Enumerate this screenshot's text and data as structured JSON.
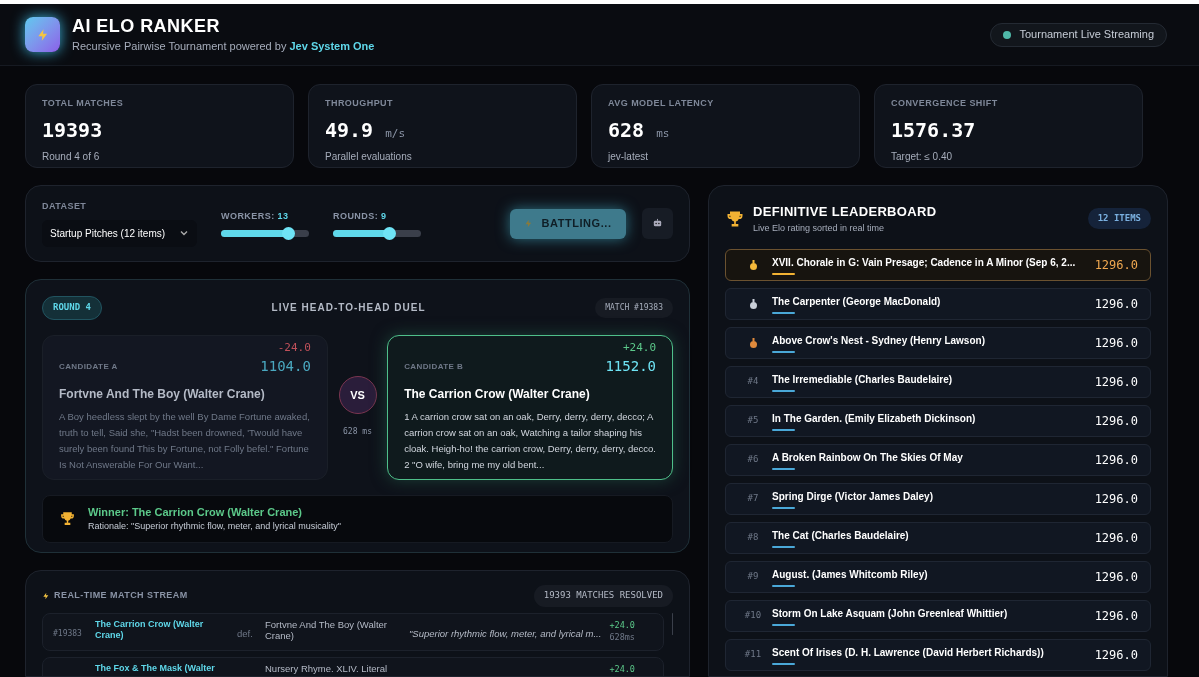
{
  "header": {
    "title": "AI ELO RANKER",
    "subtitle": "Recursive Pairwise Tournament powered by",
    "brand": "Jev System One",
    "status": "Tournament Live Streaming",
    "live": true
  },
  "stats": [
    {
      "label": "TOTAL MATCHES",
      "value": "19393",
      "note": "Round 4 of 6"
    },
    {
      "label": "THROUGHPUT",
      "value": "49.9",
      "unit": "m/s",
      "note": "Parallel evaluations"
    },
    {
      "label": "AVG MODEL LATENCY",
      "value": "628",
      "unit": "ms",
      "note": "jev-latest"
    },
    {
      "label": "CONVERGENCE SHIFT",
      "value": "1576.37",
      "note": "Target: ≤ 0.40"
    }
  ],
  "controls": {
    "dataset_label": "DATASET",
    "dataset": "Startup Pitches (12 items)",
    "sliders": [
      {
        "label": "WORKERS:",
        "value": "13",
        "level": 0.76
      },
      {
        "label": "ROUNDS:",
        "value": "9",
        "level": 0.64
      }
    ],
    "run_button": "BATTLING...",
    "running": true
  },
  "duel": {
    "round": "ROUND 4",
    "title": "LIVE HEAD-TO-HEAD DUEL",
    "match": "MATCH #19383",
    "vs": "VS",
    "latency": "628 ms",
    "candidates": [
      {
        "label": "CANDIDATE A",
        "delta": "-24.0",
        "rating": "1104.0",
        "title": "Fortvne And The Boy (Walter Crane)",
        "text": "A Boy heedless slept by the well By Dame Fortune awaked, truth to tell, Said she, \"Hadst been drowned, 'Twould have surely been found This by Fortune, not Folly befel.\" Fortune Is Not Answerable For Our Want...",
        "winner": false
      },
      {
        "label": "CANDIDATE B",
        "delta": "+24.0",
        "rating": "1152.0",
        "title": "The Carrion Crow (Walter Crane)",
        "text": "1 A carrion crow sat on an oak, Derry, derry, derry, decco; A carrion crow sat on an oak, Watching a tailor shaping his cloak. Heigh-ho! the carrion crow, Derry, derry, derry, decco. 2 \"O wife, bring me my old bent...",
        "winner": true
      }
    ],
    "winner": "Winner: The Carrion Crow (Walter Crane)",
    "rationale": "Rationale: \"Superior rhythmic flow, meter, and lyrical musicality\""
  },
  "stream": {
    "title": "REAL-TIME MATCH STREAM",
    "count": "19393 MATCHES RESOLVED",
    "rows": [
      {
        "id": "#19383",
        "winner": "The Carrion Crow (Walter Crane)",
        "def": "def.",
        "loser": "Fortvne And The Boy (Walter Crane)",
        "rationale": "\"Superior rhythmic flow, meter, and lyrical m...",
        "delta": "+24.0",
        "latency": "628ms"
      },
      {
        "winner": "The Fox & The Mask (Walter",
        "loser": "Nursery Rhyme. XLIV. Literal",
        "delta": "+24.0"
      }
    ]
  },
  "leaderboard": {
    "title": "DEFINITIVE LEADERBOARD",
    "subtitle": "Live Elo rating sorted in real time",
    "count": "12 ITEMS",
    "rows": [
      {
        "kind": "medal",
        "color": "#f5b93a",
        "title": "XVII. Chorale in G: Vain Presage; Cadence in A Minor (Sep 6, 2...",
        "score": "1296.0",
        "highlighted": true
      },
      {
        "kind": "medal",
        "color": "#c9ced8",
        "title": "The Carpenter (George MacDonald)",
        "score": "1296.0",
        "highlighted": false
      },
      {
        "kind": "medal",
        "color": "#e08a3c",
        "title": "Above Crow's Nest - Sydney (Henry Lawson)",
        "score": "1296.0",
        "highlighted": false
      },
      {
        "kind": "rank",
        "rank": "#4",
        "title": "The Irremediable (Charles Baudelaire)",
        "score": "1296.0",
        "highlighted": false
      },
      {
        "kind": "rank",
        "rank": "#5",
        "title": "In The Garden. (Emily Elizabeth Dickinson)",
        "score": "1296.0",
        "highlighted": false
      },
      {
        "kind": "rank",
        "rank": "#6",
        "title": "A Broken Rainbow On The Skies Of May",
        "score": "1296.0",
        "highlighted": false
      },
      {
        "kind": "rank",
        "rank": "#7",
        "title": "Spring Dirge (Victor James Daley)",
        "score": "1296.0",
        "highlighted": false
      },
      {
        "kind": "rank",
        "rank": "#8",
        "title": "The Cat (Charles Baudelaire)",
        "score": "1296.0",
        "highlighted": false
      },
      {
        "kind": "rank",
        "rank": "#9",
        "title": "August. (James Whitcomb Riley)",
        "score": "1296.0",
        "highlighted": false
      },
      {
        "kind": "rank",
        "rank": "#10",
        "title": "Storm On Lake Asquam (John Greenleaf Whittier)",
        "score": "1296.0",
        "highlighted": false
      },
      {
        "kind": "rank",
        "rank": "#11",
        "title": "Scent Of Irises (D. H. Lawrence (David Herbert Richards))",
        "score": "1296.0",
        "highlighted": false
      }
    ]
  }
}
